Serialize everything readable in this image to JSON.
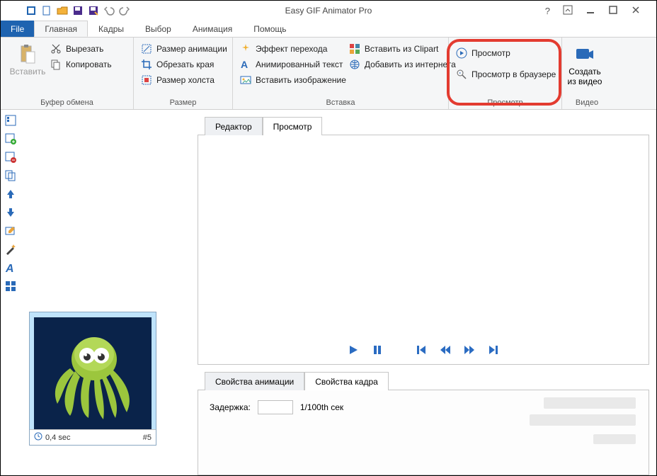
{
  "title": "Easy GIF Animator Pro",
  "tabs": {
    "file": "File",
    "main": "Главная",
    "frames": "Кадры",
    "select": "Выбор",
    "animation": "Анимация",
    "help": "Помощь"
  },
  "ribbon": {
    "clipboard": {
      "paste": "Вставить",
      "cut": "Вырезать",
      "copy": "Копировать",
      "label": "Буфер обмена"
    },
    "size": {
      "anim_size": "Размер анимации",
      "crop": "Обрезать края",
      "canvas_size": "Размер холста",
      "label": "Размер"
    },
    "insert": {
      "transition": "Эффект перехода",
      "anim_text": "Анимированный текст",
      "insert_image": "Вставить изображение",
      "clipart": "Вставить из Clipart",
      "from_internet": "Добавить из интернета",
      "label": "Вставка"
    },
    "preview": {
      "preview": "Просмотр",
      "preview_browser": "Просмотр в браузере",
      "label": "Просмотр"
    },
    "video": {
      "create": "Создать из видео",
      "label": "Видео"
    }
  },
  "center": {
    "editor_tab": "Редактор",
    "preview_tab": "Просмотр",
    "anim_props_tab": "Свойства анимации",
    "frame_props_tab": "Свойства кадра",
    "delay_label": "Задержка:",
    "delay_unit": "1/100th сек",
    "delay_value": ""
  },
  "frame": {
    "duration": "0,4 sec",
    "index": "#5"
  }
}
